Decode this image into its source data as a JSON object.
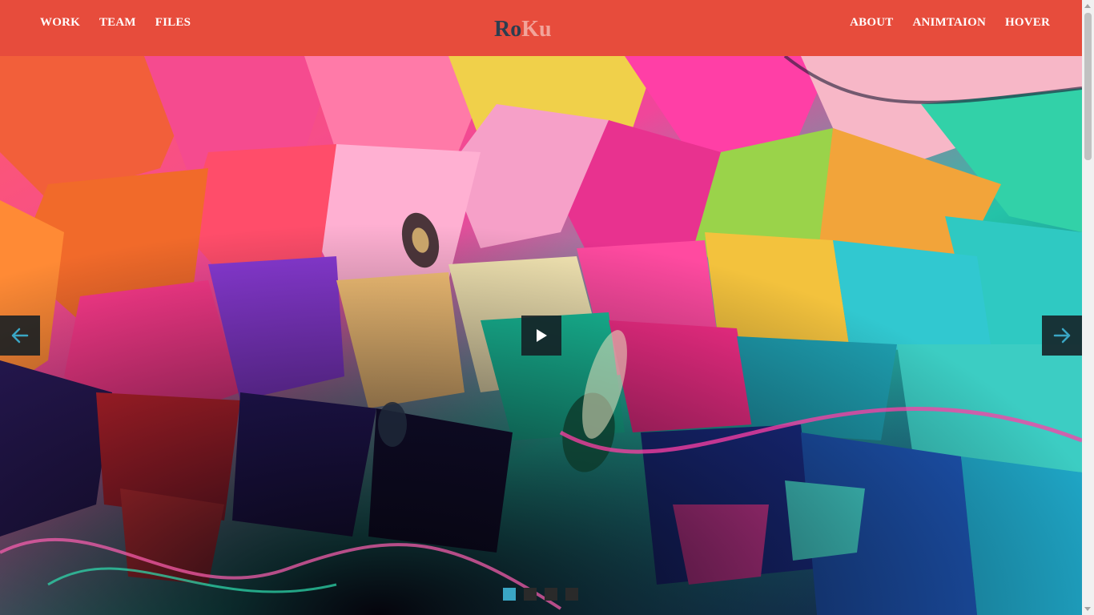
{
  "nav": {
    "left": [
      "WORK",
      "TEAM",
      "FILES"
    ],
    "right": [
      "ABOUT",
      "ANIMTAION",
      "HOVER"
    ]
  },
  "logo": {
    "part1": "Ro",
    "part2": "Ku"
  },
  "colors": {
    "header_bg": "#e74c3c",
    "logo_dark": "#2c3e50",
    "logo_light": "#f2a49a",
    "dot_active": "#3aa6c4",
    "control_bg": "#141e23"
  },
  "slider": {
    "icons": {
      "prev": "arrow-left-icon",
      "next": "arrow-right-icon",
      "play": "play-icon"
    },
    "slides": 4,
    "active_slide": 1
  }
}
